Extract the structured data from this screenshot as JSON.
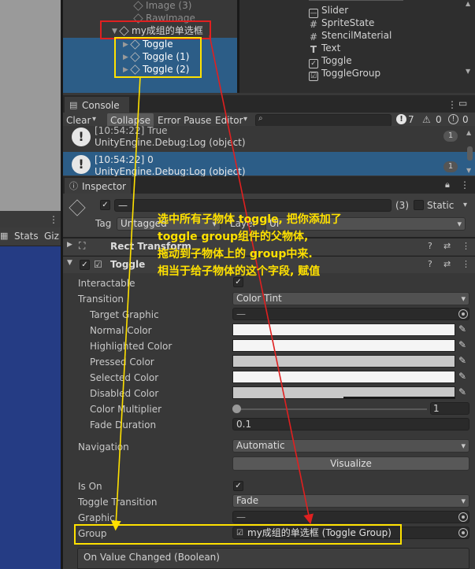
{
  "hierarchy": {
    "items": [
      {
        "label": "Image (3)",
        "dim": true
      },
      {
        "label": "RawImage",
        "dim": true
      },
      {
        "label": "my成组的单选框",
        "dim": false
      },
      {
        "label": "Toggle"
      },
      {
        "label": "Toggle (1)"
      },
      {
        "label": "Toggle (2)"
      }
    ]
  },
  "component_list": {
    "items": [
      {
        "label": "Slider",
        "icon": "slider-icon"
      },
      {
        "label": "SpriteState",
        "icon": "hash-icon"
      },
      {
        "label": "StencilMaterial",
        "icon": "hash-icon"
      },
      {
        "label": "Text",
        "icon": "text-icon"
      },
      {
        "label": "Toggle",
        "icon": "checkbox-icon"
      },
      {
        "label": "ToggleGroup",
        "icon": "toggle-group-icon"
      }
    ]
  },
  "console": {
    "tab": "Console",
    "toolbar": {
      "clear": "Clear",
      "collapse": "Collapse",
      "error_pause": "Error Pause",
      "editor": "Editor"
    },
    "counts": {
      "info": "7",
      "warn": "0",
      "error": "0"
    },
    "logs": [
      {
        "time": "[10:54:22] True",
        "source": "UnityEngine.Debug:Log (object)",
        "count": "1"
      },
      {
        "time": "[10:54:22] 0",
        "source": "UnityEngine.Debug:Log (object)",
        "count": "1"
      }
    ]
  },
  "left_panel": {
    "stats": "Stats",
    "gizmos": "Giz"
  },
  "inspector": {
    "tab": "Inspector",
    "object_name": "—",
    "object_count": "(3)",
    "static_label": "Static",
    "tag_label": "Tag",
    "tag_value": "Untagged",
    "layer_label": "Layer",
    "layer_value": "UI",
    "rect_transform": "Rect Transform",
    "toggle_component": "Toggle",
    "fields": {
      "interactable": "Interactable",
      "transition": "Transition",
      "transition_value": "Color Tint",
      "target_graphic": "Target Graphic",
      "target_graphic_value": "—",
      "normal_color": "Normal Color",
      "highlighted_color": "Highlighted Color",
      "pressed_color": "Pressed Color",
      "selected_color": "Selected Color",
      "disabled_color": "Disabled Color",
      "color_multiplier": "Color Multiplier",
      "color_multiplier_value": "1",
      "fade_duration": "Fade Duration",
      "fade_duration_value": "0.1",
      "navigation": "Navigation",
      "navigation_value": "Automatic",
      "visualize": "Visualize",
      "is_on": "Is On",
      "toggle_transition": "Toggle Transition",
      "toggle_transition_value": "Fade",
      "graphic": "Graphic",
      "graphic_value": "—",
      "group": "Group",
      "group_value": "my成组的单选框 (Toggle Group)",
      "on_value_changed": "On Value Changed (Boolean)"
    }
  },
  "annotation": {
    "lines": [
      "选中所有子物体 toggle, 把你添加了",
      "toggle group组件的父物体,",
      "拖动到子物体上的 group中来.",
      "相当于给子物体的这个字段, 赋值"
    ]
  },
  "colors": {
    "selection": "#2c5d87",
    "annotation_yellow": "#ffe100",
    "annotation_red": "#e02020"
  }
}
